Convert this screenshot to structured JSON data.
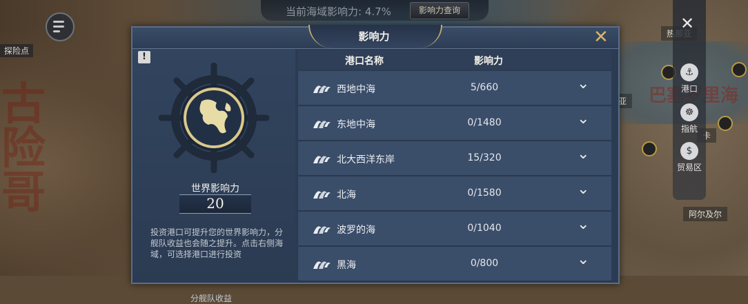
{
  "hud": {
    "current_influence": "当前海域影响力: 4.7%",
    "query_button": "影响力查询"
  },
  "map": {
    "left_label": "探险点",
    "label_right_top": "热那亚",
    "label_right_mid": "亚",
    "label_right_lower": "阿尔及尔",
    "label_right_small": "卡",
    "big_text_right": "巴塞罗里海",
    "big_text_left": "古险哥"
  },
  "right_rail": {
    "close_icon": "close-icon",
    "items": [
      {
        "label": "港口",
        "icon": "port-icon"
      },
      {
        "label": "指航",
        "icon": "helm-icon"
      },
      {
        "label": "贸易区",
        "icon": "trade-icon"
      }
    ]
  },
  "dialog": {
    "title": "影响力",
    "close_icon": "close-x-icon",
    "info_label": "!",
    "world_influence_label": "世界影响力",
    "world_influence_value": "20",
    "description": "投资港口可提升您的世界影响力，分舰队收益也会随之提升。点击右侧海域，可选择港口进行投资",
    "subtitle": "分舰队收益",
    "table": {
      "headers": [
        "港口名称",
        "影响力"
      ],
      "rows": [
        {
          "name": "西地中海",
          "value": "5/660"
        },
        {
          "name": "东地中海",
          "value": "0/1480"
        },
        {
          "name": "北大西洋东岸",
          "value": "15/320"
        },
        {
          "name": "北海",
          "value": "0/1580"
        },
        {
          "name": "波罗的海",
          "value": "0/1040"
        },
        {
          "name": "黑海",
          "value": "0/800"
        }
      ]
    }
  }
}
